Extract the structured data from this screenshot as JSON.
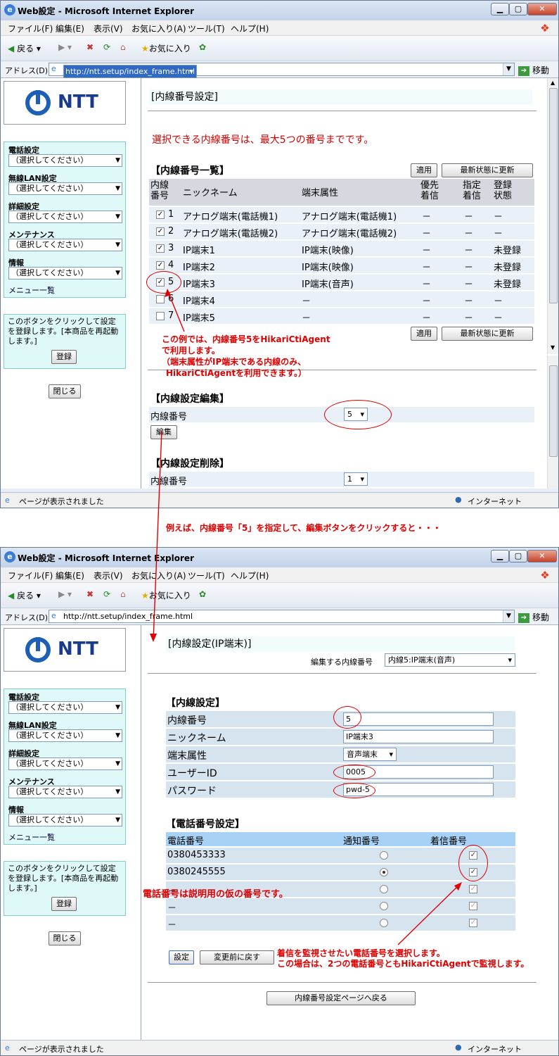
{
  "window": {
    "title": "Web設定 - Microsoft Internet Explorer",
    "menu": [
      "ファイル(F)",
      "編集(E)",
      "表示(V)",
      "お気に入り(A)",
      "ツール(T)",
      "ヘルプ(H)"
    ],
    "back_label": "戻る",
    "favorites_label": "お気に入り",
    "address_label": "アドレス(D)",
    "url": "http://ntt.setup/index_frame.html",
    "go_label": "移動",
    "status_text": "ページが表示されました",
    "zone_text": "インターネット"
  },
  "sidebar": {
    "logo_text": "NTT",
    "sections": [
      {
        "label": "電話設定",
        "value": "（選択してください）"
      },
      {
        "label": "無線LAN設定",
        "value": "（選択してください）"
      },
      {
        "label": "詳細設定",
        "value": "（選択してください）"
      },
      {
        "label": "メンテナンス",
        "value": "（選択してください）"
      },
      {
        "label": "情報",
        "value": "（選択してください）"
      }
    ],
    "menu_list": "メニュー一覧",
    "register_note": "このボタンをクリックして設定を登録します。[本商品を再起動します。]",
    "register_button": "登録",
    "close_button": "閉じる"
  },
  "top": {
    "heading": "[内線番号設定]",
    "notice": "選択できる内線番号は、最大5つの番号までです。",
    "list_heading": "【内線番号一覧】",
    "apply_button": "適用",
    "refresh_button": "最新状態に更新",
    "columns": [
      "内線番号",
      "ニックネーム",
      "端末属性",
      "優先着信",
      "指定着信",
      "登録状態"
    ],
    "rows": [
      {
        "checked": true,
        "no": "1",
        "nickname": "アナログ端末(電話機1)",
        "type": "アナログ端末(電話機1)",
        "pri": "－",
        "spec": "－",
        "status": "－"
      },
      {
        "checked": true,
        "no": "2",
        "nickname": "アナログ端末(電話機2)",
        "type": "アナログ端末(電話機2)",
        "pri": "－",
        "spec": "－",
        "status": "－"
      },
      {
        "checked": true,
        "no": "3",
        "nickname": "IP端末1",
        "type": "IP端末(映像)",
        "pri": "－",
        "spec": "－",
        "status": "未登録"
      },
      {
        "checked": true,
        "no": "4",
        "nickname": "IP端末2",
        "type": "IP端末(映像)",
        "pri": "－",
        "spec": "－",
        "status": "未登録"
      },
      {
        "checked": true,
        "no": "5",
        "nickname": "IP端末3",
        "type": "IP端末(音声)",
        "pri": "－",
        "spec": "－",
        "status": "未登録"
      },
      {
        "checked": false,
        "no": "6",
        "nickname": "IP端末4",
        "type": "－",
        "pri": "－",
        "spec": "－",
        "status": "－"
      },
      {
        "checked": false,
        "no": "7",
        "nickname": "IP端末5",
        "type": "－",
        "pri": "－",
        "spec": "－",
        "status": "－"
      }
    ],
    "edit_heading": "【内線設定編集】",
    "edit_label": "内線番号",
    "edit_value": "5",
    "edit_button": "編集",
    "delete_heading": "【内線設定削除】",
    "delete_label": "内線番号",
    "delete_value": "1"
  },
  "bottom": {
    "heading": "[内線設定(IP端末)]",
    "edit_target_label": "編集する内線番号",
    "edit_target_value": "内線5:IP端末(音声)",
    "settings_heading": "【内線設定】",
    "fields": [
      {
        "label": "内線番号",
        "value": "5"
      },
      {
        "label": "ニックネーム",
        "value": "IP端末3"
      },
      {
        "label": "端末属性",
        "value": "音声端末"
      },
      {
        "label": "ユーザーID",
        "value": "0005"
      },
      {
        "label": "パスワード",
        "value": "pwd-5"
      }
    ],
    "phone_heading": "【電話番号設定】",
    "phone_columns": [
      "電話番号",
      "通知番号",
      "着信番号"
    ],
    "phones": [
      {
        "number": "0380453333",
        "notify": false,
        "incoming": true
      },
      {
        "number": "0380245555",
        "notify": true,
        "incoming": true
      },
      {
        "number": "－",
        "notify": false,
        "incoming": true
      },
      {
        "number": "－",
        "notify": false,
        "incoming": true
      },
      {
        "number": "－",
        "notify": false,
        "incoming": true
      }
    ],
    "set_button": "設定",
    "revert_button": "変更前に戻す",
    "back_button": "内線番号設定ページへ戻る"
  },
  "annotations": {
    "example_a": "この例では、内線番号5をHikariCtiAgent",
    "example_b": "で利用します。",
    "example_c": "（端末属性がIP端末である内線のみ、",
    "example_d": "HikariCtiAgentを利用できます。）",
    "middle": "例えば、内線番号「5」を指定して、編集ボタンをクリックすると・・・",
    "phone_note": "電話番号は説明用の仮の番号です。",
    "watch_a": "着信を監視させたい電話番号を選択します。",
    "watch_b": "この場合は、2つの電話番号ともHikariCtiAgentで監視します。"
  }
}
